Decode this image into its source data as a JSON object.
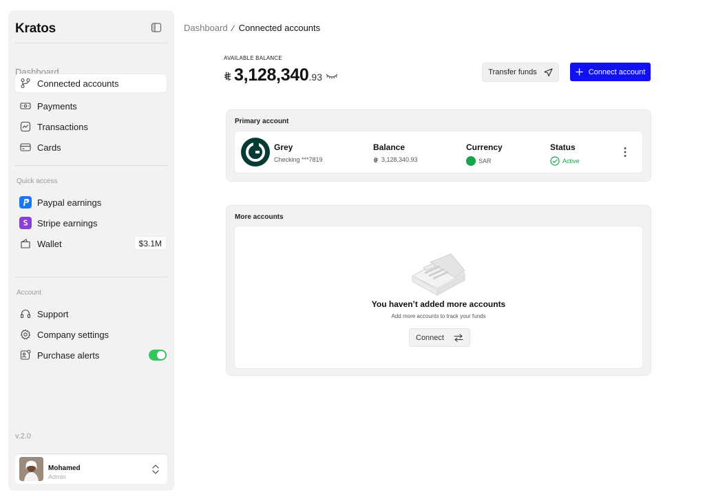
{
  "sidebar": {
    "brand": "Kratos",
    "dashboard_label": "Dashboard",
    "nav": [
      {
        "label": "Connected accounts",
        "icon": "connected-accounts-icon"
      },
      {
        "label": "Payments",
        "icon": "payments-icon"
      },
      {
        "label": "Transactions",
        "icon": "transactions-icon"
      },
      {
        "label": "Cards",
        "icon": "cards-icon"
      }
    ],
    "quick_access": {
      "label": "Quick access",
      "items": [
        {
          "label": "Paypal earnings",
          "icon": "paypal-icon"
        },
        {
          "label": "Stripe earnings",
          "icon": "stripe-icon"
        },
        {
          "label": "Wallet",
          "icon": "wallet-icon",
          "badge": "$3.1M"
        }
      ]
    },
    "account": {
      "label": "Account",
      "items": [
        {
          "label": "Support",
          "icon": "headset-icon"
        },
        {
          "label": "Company settings",
          "icon": "gear-icon"
        },
        {
          "label": "Purchase alerts",
          "icon": "alerts-icon",
          "toggle_on": true
        }
      ]
    },
    "version": "v.2.0",
    "user": {
      "name": "Mohamed",
      "role": "Admin"
    }
  },
  "breadcrumb": {
    "root": "Dashboard",
    "separator": "⁄",
    "current": "Connected accounts"
  },
  "balance": {
    "label": "AVAILABLE BALANCE",
    "currency_symbol": "⃁",
    "whole": "3,128,340",
    "decimal": ".93"
  },
  "actions": {
    "transfer": "Transfer funds",
    "connect": "Connect account"
  },
  "primary": {
    "title": "Primary account",
    "name": "Grey",
    "number": "Checking ***7819",
    "balance_head": "Balance",
    "balance_value": "3,128,340.93",
    "currency_head": "Currency",
    "currency_value": "SAR",
    "status_head": "Status",
    "status_value": "Active"
  },
  "more": {
    "title": "More accounts",
    "empty_title": "You haven’t added more accounts",
    "empty_sub": "Add more accounts to track your funds",
    "connect": "Connect"
  },
  "colors": {
    "accent": "#1010f0",
    "active_green": "#16a34a",
    "toggle_green": "#34c659"
  }
}
